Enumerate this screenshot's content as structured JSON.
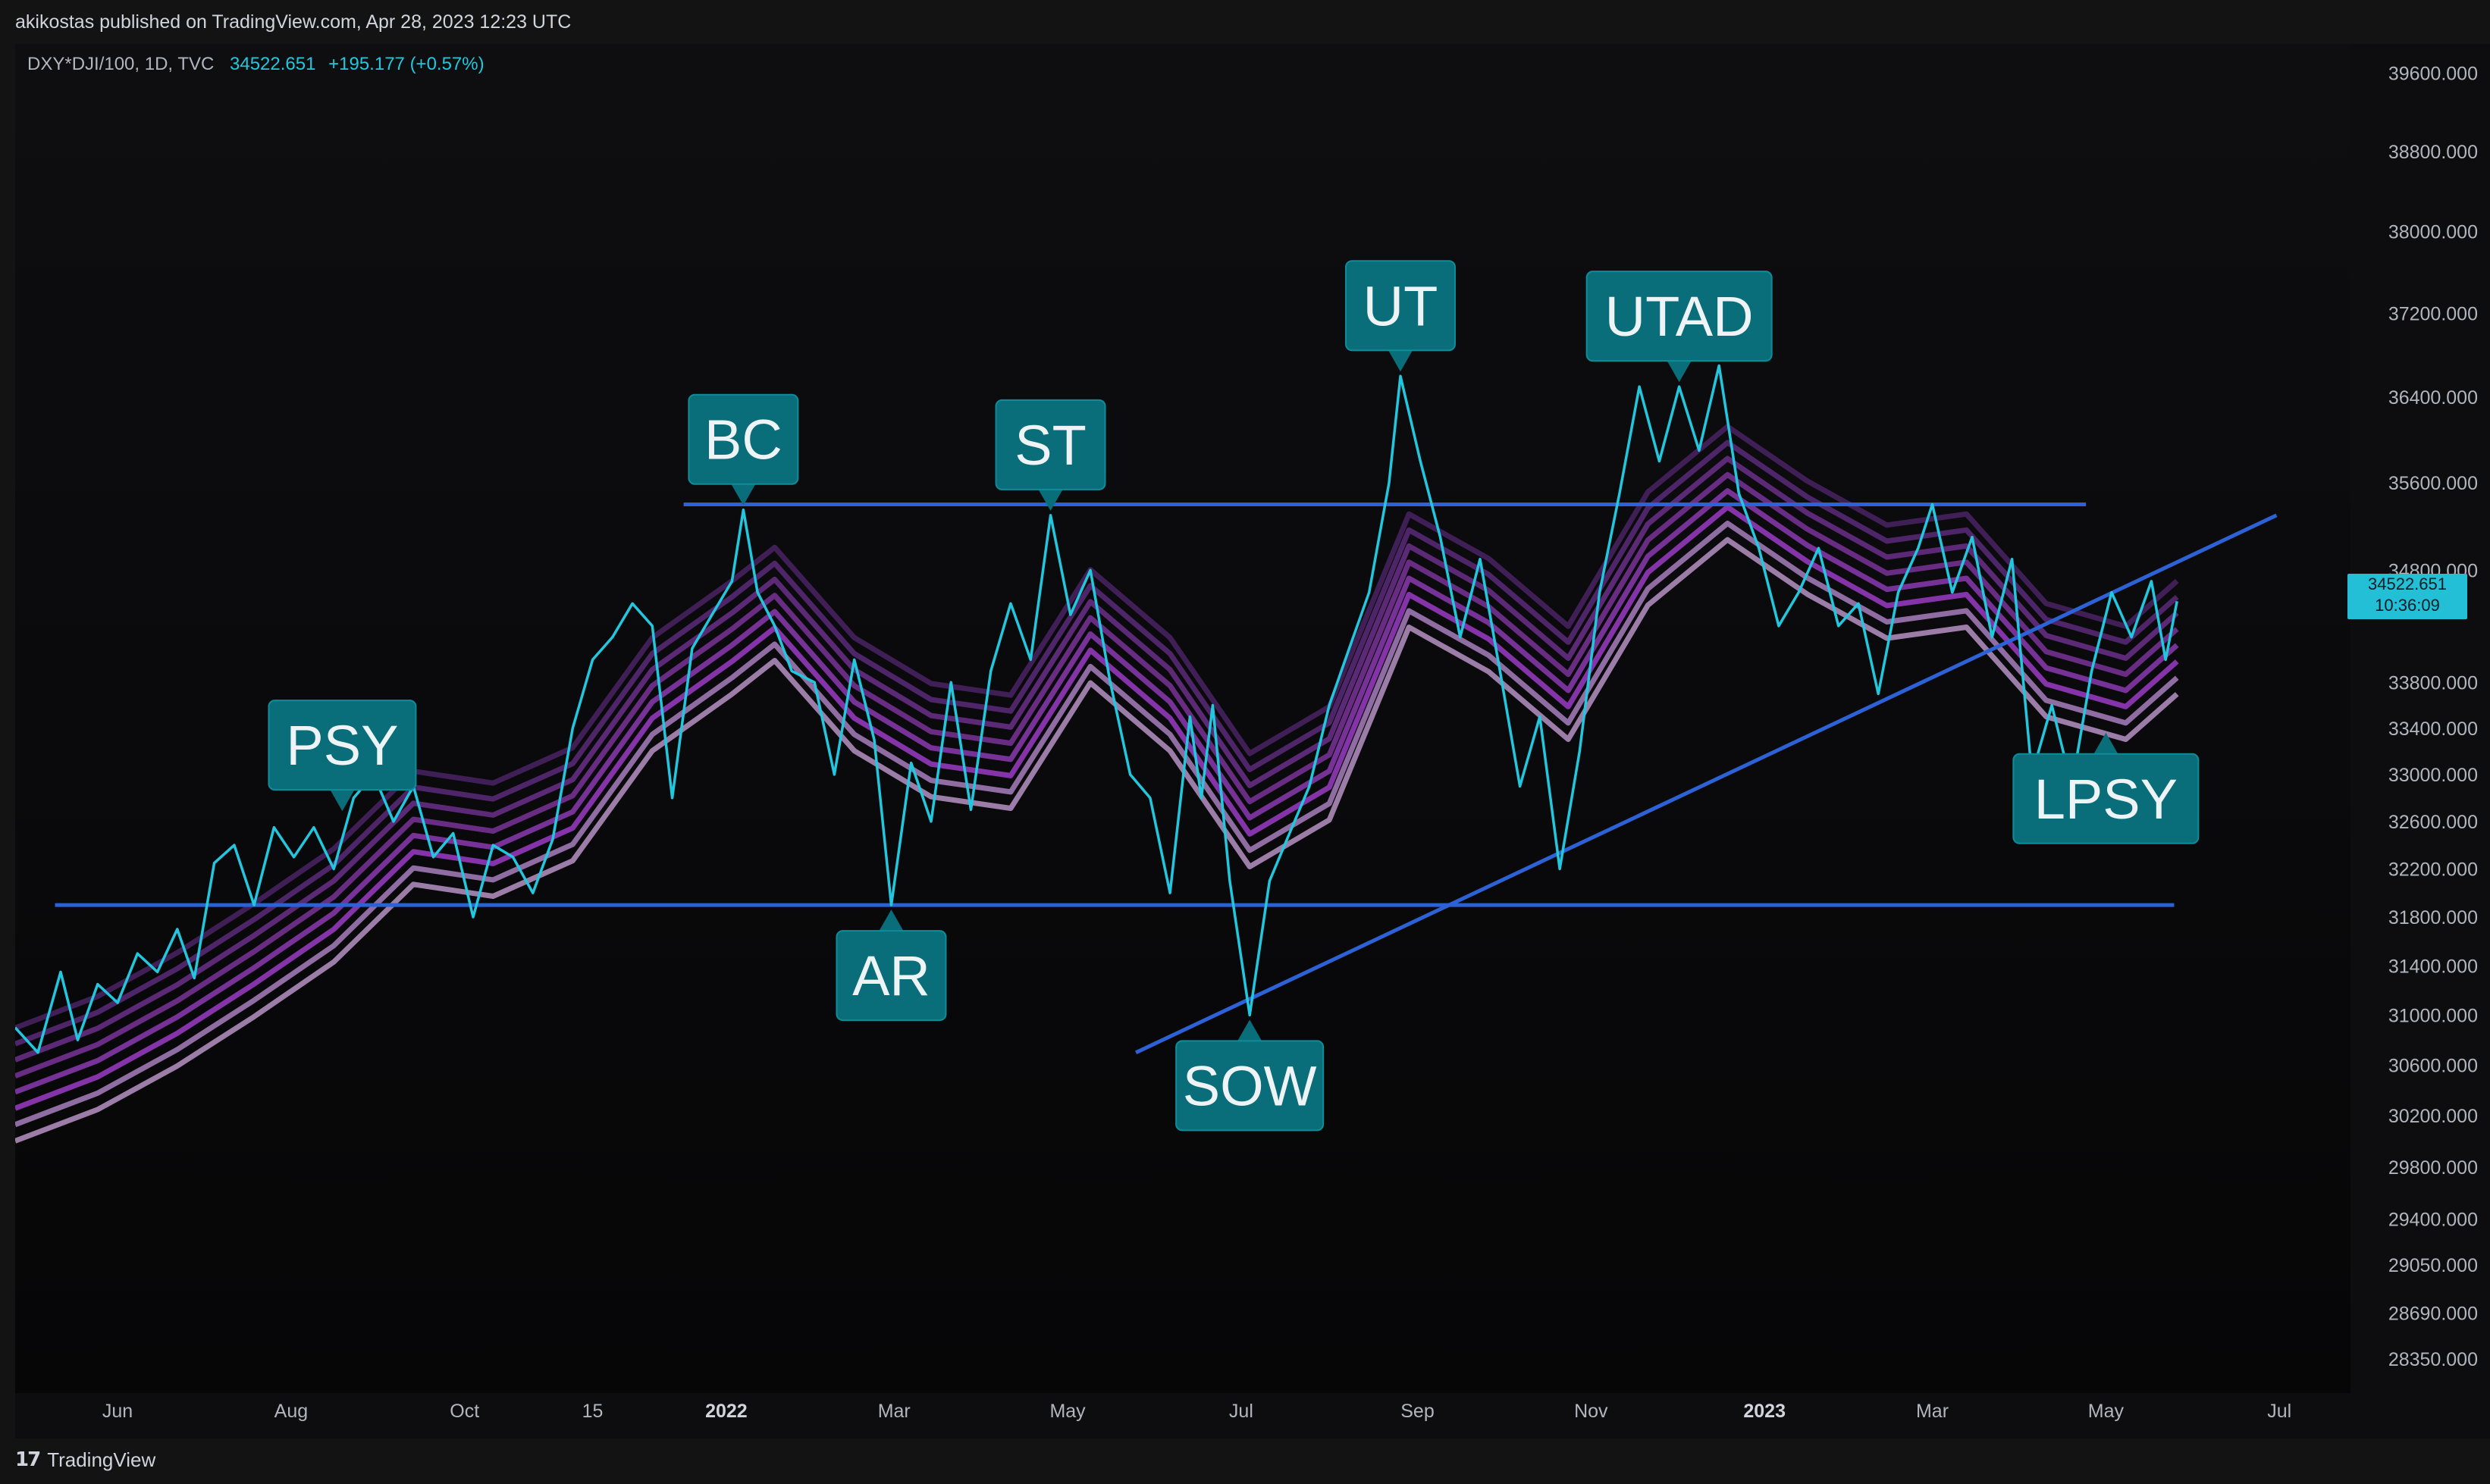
{
  "header": {
    "published": "akikostas published on TradingView.com, Apr 28, 2023 12:23 UTC"
  },
  "legend": {
    "symbol": "DXY*DJI/100, 1D, TVC",
    "value": "34522.651",
    "change": "+195.177 (+0.57%)"
  },
  "price_tag": {
    "price": "34522.651",
    "countdown": "10:36:09"
  },
  "footer": {
    "brand": "TradingView",
    "logo_glyph": "17"
  },
  "colors": {
    "price_line": "#22c7de",
    "ribbon_light": "#b592c4",
    "ribbon_mid": "#9b3bc4",
    "ribbon_dark": "#5c2a7a",
    "trend_line": "#2d62d6",
    "label_bg": "#0a6e7a",
    "label_border": "#0f8c99",
    "price_tag_bg": "#22bfd6"
  },
  "chart_data": {
    "type": "line",
    "y_scale": "log",
    "ylim": [
      28100,
      39900
    ],
    "y_ticks": [
      "39600.000",
      "38800.000",
      "38000.000",
      "37200.000",
      "36400.000",
      "35600.000",
      "34800.000",
      "33800.000",
      "33400.000",
      "33000.000",
      "32600.000",
      "32200.000",
      "31800.000",
      "31400.000",
      "31000.000",
      "30600.000",
      "30200.000",
      "29800.000",
      "29400.000",
      "29050.000",
      "28690.000",
      "28350.000"
    ],
    "x_ticks": [
      {
        "label": "Jun",
        "date": "2021-06-01",
        "bold": false
      },
      {
        "label": "Aug",
        "date": "2021-08-01",
        "bold": false
      },
      {
        "label": "Oct",
        "date": "2021-10-01",
        "bold": false
      },
      {
        "label": "15",
        "date": "2021-11-15",
        "bold": false
      },
      {
        "label": "2022",
        "date": "2022-01-01",
        "bold": true
      },
      {
        "label": "Mar",
        "date": "2022-03-01",
        "bold": false
      },
      {
        "label": "May",
        "date": "2022-05-01",
        "bold": false
      },
      {
        "label": "Jul",
        "date": "2022-07-01",
        "bold": false
      },
      {
        "label": "Sep",
        "date": "2022-09-01",
        "bold": false
      },
      {
        "label": "Nov",
        "date": "2022-11-01",
        "bold": false
      },
      {
        "label": "2023",
        "date": "2023-01-01",
        "bold": true
      },
      {
        "label": "Mar",
        "date": "2023-03-01",
        "bold": false
      },
      {
        "label": "May",
        "date": "2023-05-01",
        "bold": false
      },
      {
        "label": "Jul",
        "date": "2023-07-01",
        "bold": false
      }
    ],
    "x_range": [
      "2021-04-26",
      "2023-07-26"
    ],
    "series": [
      {
        "values": [
          [
            "2021-04-26",
            30900
          ],
          [
            "2021-05-04",
            30700
          ],
          [
            "2021-05-12",
            31350
          ],
          [
            "2021-05-18",
            30800
          ],
          [
            "2021-05-25",
            31250
          ],
          [
            "2021-06-01",
            31100
          ],
          [
            "2021-06-08",
            31500
          ],
          [
            "2021-06-15",
            31350
          ],
          [
            "2021-06-22",
            31700
          ],
          [
            "2021-06-28",
            31300
          ],
          [
            "2021-07-05",
            32250
          ],
          [
            "2021-07-12",
            32400
          ],
          [
            "2021-07-19",
            31900
          ],
          [
            "2021-07-26",
            32550
          ],
          [
            "2021-08-02",
            32300
          ],
          [
            "2021-08-09",
            32550
          ],
          [
            "2021-08-16",
            32200
          ],
          [
            "2021-08-23",
            32800
          ],
          [
            "2021-08-30",
            33000
          ],
          [
            "2021-09-06",
            32600
          ],
          [
            "2021-09-13",
            32900
          ],
          [
            "2021-09-20",
            32300
          ],
          [
            "2021-09-27",
            32500
          ],
          [
            "2021-10-04",
            31800
          ],
          [
            "2021-10-11",
            32400
          ],
          [
            "2021-10-18",
            32300
          ],
          [
            "2021-10-25",
            32000
          ],
          [
            "2021-11-01",
            32450
          ],
          [
            "2021-11-08",
            33400
          ],
          [
            "2021-11-15",
            34000
          ],
          [
            "2021-11-22",
            34200
          ],
          [
            "2021-11-29",
            34500
          ],
          [
            "2021-12-06",
            34300
          ],
          [
            "2021-12-13",
            32800
          ],
          [
            "2021-12-20",
            34100
          ],
          [
            "2021-12-27",
            34400
          ],
          [
            "2022-01-03",
            34700
          ],
          [
            "2022-01-07",
            35350
          ],
          [
            "2022-01-12",
            34600
          ],
          [
            "2022-01-18",
            34300
          ],
          [
            "2022-01-24",
            33900
          ],
          [
            "2022-02-01",
            33800
          ],
          [
            "2022-02-08",
            33000
          ],
          [
            "2022-02-15",
            34000
          ],
          [
            "2022-02-22",
            33300
          ],
          [
            "2022-02-28",
            31900
          ],
          [
            "2022-03-07",
            33100
          ],
          [
            "2022-03-14",
            32600
          ],
          [
            "2022-03-21",
            33800
          ],
          [
            "2022-03-28",
            32700
          ],
          [
            "2022-04-04",
            33900
          ],
          [
            "2022-04-11",
            34500
          ],
          [
            "2022-04-18",
            34000
          ],
          [
            "2022-04-25",
            35300
          ],
          [
            "2022-05-02",
            34400
          ],
          [
            "2022-05-09",
            34800
          ],
          [
            "2022-05-16",
            33800
          ],
          [
            "2022-05-23",
            33000
          ],
          [
            "2022-05-30",
            32800
          ],
          [
            "2022-06-06",
            32000
          ],
          [
            "2022-06-13",
            33500
          ],
          [
            "2022-06-17",
            32800
          ],
          [
            "2022-06-21",
            33600
          ],
          [
            "2022-06-27",
            32100
          ],
          [
            "2022-07-04",
            31000
          ],
          [
            "2022-07-11",
            32100
          ],
          [
            "2022-07-18",
            32500
          ],
          [
            "2022-07-25",
            32900
          ],
          [
            "2022-08-01",
            33600
          ],
          [
            "2022-08-08",
            34100
          ],
          [
            "2022-08-15",
            34600
          ],
          [
            "2022-08-22",
            35600
          ],
          [
            "2022-08-26",
            36600
          ],
          [
            "2022-09-02",
            35800
          ],
          [
            "2022-09-09",
            35100
          ],
          [
            "2022-09-16",
            34200
          ],
          [
            "2022-09-23",
            34900
          ],
          [
            "2022-09-30",
            33900
          ],
          [
            "2022-10-07",
            32900
          ],
          [
            "2022-10-14",
            33500
          ],
          [
            "2022-10-21",
            32200
          ],
          [
            "2022-10-28",
            33200
          ],
          [
            "2022-11-04",
            34600
          ],
          [
            "2022-11-11",
            35500
          ],
          [
            "2022-11-18",
            36500
          ],
          [
            "2022-11-25",
            35800
          ],
          [
            "2022-12-02",
            36500
          ],
          [
            "2022-12-09",
            35900
          ],
          [
            "2022-12-16",
            36700
          ],
          [
            "2022-12-23",
            35500
          ],
          [
            "2022-12-30",
            35000
          ],
          [
            "2023-01-06",
            34300
          ],
          [
            "2023-01-13",
            34600
          ],
          [
            "2023-01-20",
            35000
          ],
          [
            "2023-01-27",
            34300
          ],
          [
            "2023-02-03",
            34500
          ],
          [
            "2023-02-10",
            33700
          ],
          [
            "2023-02-17",
            34600
          ],
          [
            "2023-02-24",
            35000
          ],
          [
            "2023-03-01",
            35400
          ],
          [
            "2023-03-08",
            34600
          ],
          [
            "2023-03-15",
            35100
          ],
          [
            "2023-03-22",
            34200
          ],
          [
            "2023-03-29",
            34900
          ],
          [
            "2023-04-05",
            33000
          ],
          [
            "2023-04-12",
            33600
          ],
          [
            "2023-04-19",
            32900
          ],
          [
            "2023-04-26",
            33900
          ],
          [
            "2023-05-03",
            34600
          ],
          [
            "2023-05-10",
            34200
          ],
          [
            "2023-05-17",
            34700
          ],
          [
            "2023-05-22",
            34000
          ],
          [
            "2023-05-26",
            34520
          ]
        ]
      }
    ],
    "ribbon": {
      "band_count": 8,
      "center": [
        [
          "2021-04-26",
          30450
        ],
        [
          "2021-05-25",
          30700
        ],
        [
          "2021-06-22",
          31050
        ],
        [
          "2021-07-19",
          31450
        ],
        [
          "2021-08-16",
          31900
        ],
        [
          "2021-09-13",
          32550
        ],
        [
          "2021-10-11",
          32450
        ],
        [
          "2021-11-08",
          32750
        ],
        [
          "2021-12-06",
          33700
        ],
        [
          "2022-01-03",
          34200
        ],
        [
          "2022-01-18",
          34500
        ],
        [
          "2022-02-15",
          33700
        ],
        [
          "2022-03-14",
          33300
        ],
        [
          "2022-04-11",
          33200
        ],
        [
          "2022-05-09",
          34300
        ],
        [
          "2022-06-06",
          33700
        ],
        [
          "2022-07-04",
          32700
        ],
        [
          "2022-08-01",
          33100
        ],
        [
          "2022-08-29",
          34800
        ],
        [
          "2022-09-26",
          34400
        ],
        [
          "2022-10-24",
          33800
        ],
        [
          "2022-11-21",
          35000
        ],
        [
          "2022-12-19",
          35600
        ],
        [
          "2023-01-16",
          35100
        ],
        [
          "2023-02-13",
          34700
        ],
        [
          "2023-03-13",
          34800
        ],
        [
          "2023-04-10",
          34000
        ],
        [
          "2023-05-08",
          33800
        ],
        [
          "2023-05-26",
          34200
        ]
      ]
    },
    "lines": [
      {
        "name": "resistance",
        "from": [
          "2021-12-17",
          35400
        ],
        "to": [
          "2023-04-24",
          35400
        ]
      },
      {
        "name": "support",
        "from": [
          "2021-05-10",
          31900
        ],
        "to": [
          "2023-05-25",
          31900
        ]
      },
      {
        "name": "uptrend",
        "from": [
          "2022-05-25",
          30700
        ],
        "to": [
          "2023-06-30",
          35300
        ]
      }
    ],
    "annotations": [
      {
        "text": "PSY",
        "date": "2021-08-19",
        "value": 32650,
        "placement": "above"
      },
      {
        "text": "BC",
        "date": "2022-01-07",
        "value": 35350,
        "placement": "above"
      },
      {
        "text": "ST",
        "date": "2022-04-25",
        "value": 35300,
        "placement": "above"
      },
      {
        "text": "UT",
        "date": "2022-08-26",
        "value": 36600,
        "placement": "above"
      },
      {
        "text": "UTAD",
        "date": "2022-12-02",
        "value": 36500,
        "placement": "above"
      },
      {
        "text": "AR",
        "date": "2022-02-28",
        "value": 31900,
        "placement": "below"
      },
      {
        "text": "SOW",
        "date": "2022-07-04",
        "value": 31000,
        "placement": "below"
      },
      {
        "text": "LPSY",
        "date": "2023-05-01",
        "value": 33400,
        "placement": "below"
      }
    ],
    "last_price": 34522.651
  }
}
